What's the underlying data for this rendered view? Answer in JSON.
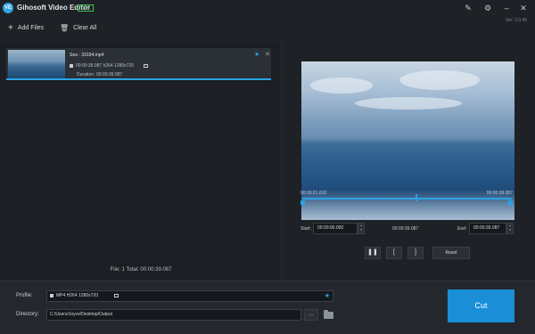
{
  "window": {
    "title": "Gihosoft Video Editor",
    "badge": "TRIAL",
    "version": "Ver: 2.0.46",
    "icons": [
      "register-icon",
      "settings-icon",
      "minimize-icon",
      "close-icon"
    ]
  },
  "toolbar": {
    "add_files": "Add Files",
    "clear_all": "Clear All"
  },
  "file_list": {
    "items": [
      {
        "name": "Sea - 33194.mp4",
        "duration_info": "00:00:39.087 h264 1280x720",
        "duration_label": "Duration:",
        "duration": "00:00:39.087"
      }
    ],
    "summary": "File: 1   Total: 00:00:39.087"
  },
  "player": {
    "current_time": "00:00:21.610",
    "total_time": "00:00:39.087",
    "start_label": "Start:",
    "start_value": "00:00:00.000",
    "mid_time": "00:00:39.087",
    "end_label": "End:",
    "end_value": "00:00:39.087",
    "controls": {
      "pause": "❚❚",
      "mark_in": "[",
      "mark_out": "]",
      "reset": "Reset"
    }
  },
  "output": {
    "profile_label": "Profile:",
    "profile_value": "MP4 H264 1280x720",
    "directory_label": "Directory:",
    "directory_value": "C:/Users/Joyce/Desktop/Output",
    "browse": "...",
    "cut": "Cut"
  },
  "colors": {
    "accent": "#2aa3e6",
    "cut": "#1a8fd8",
    "badge": "#3ec15a"
  }
}
